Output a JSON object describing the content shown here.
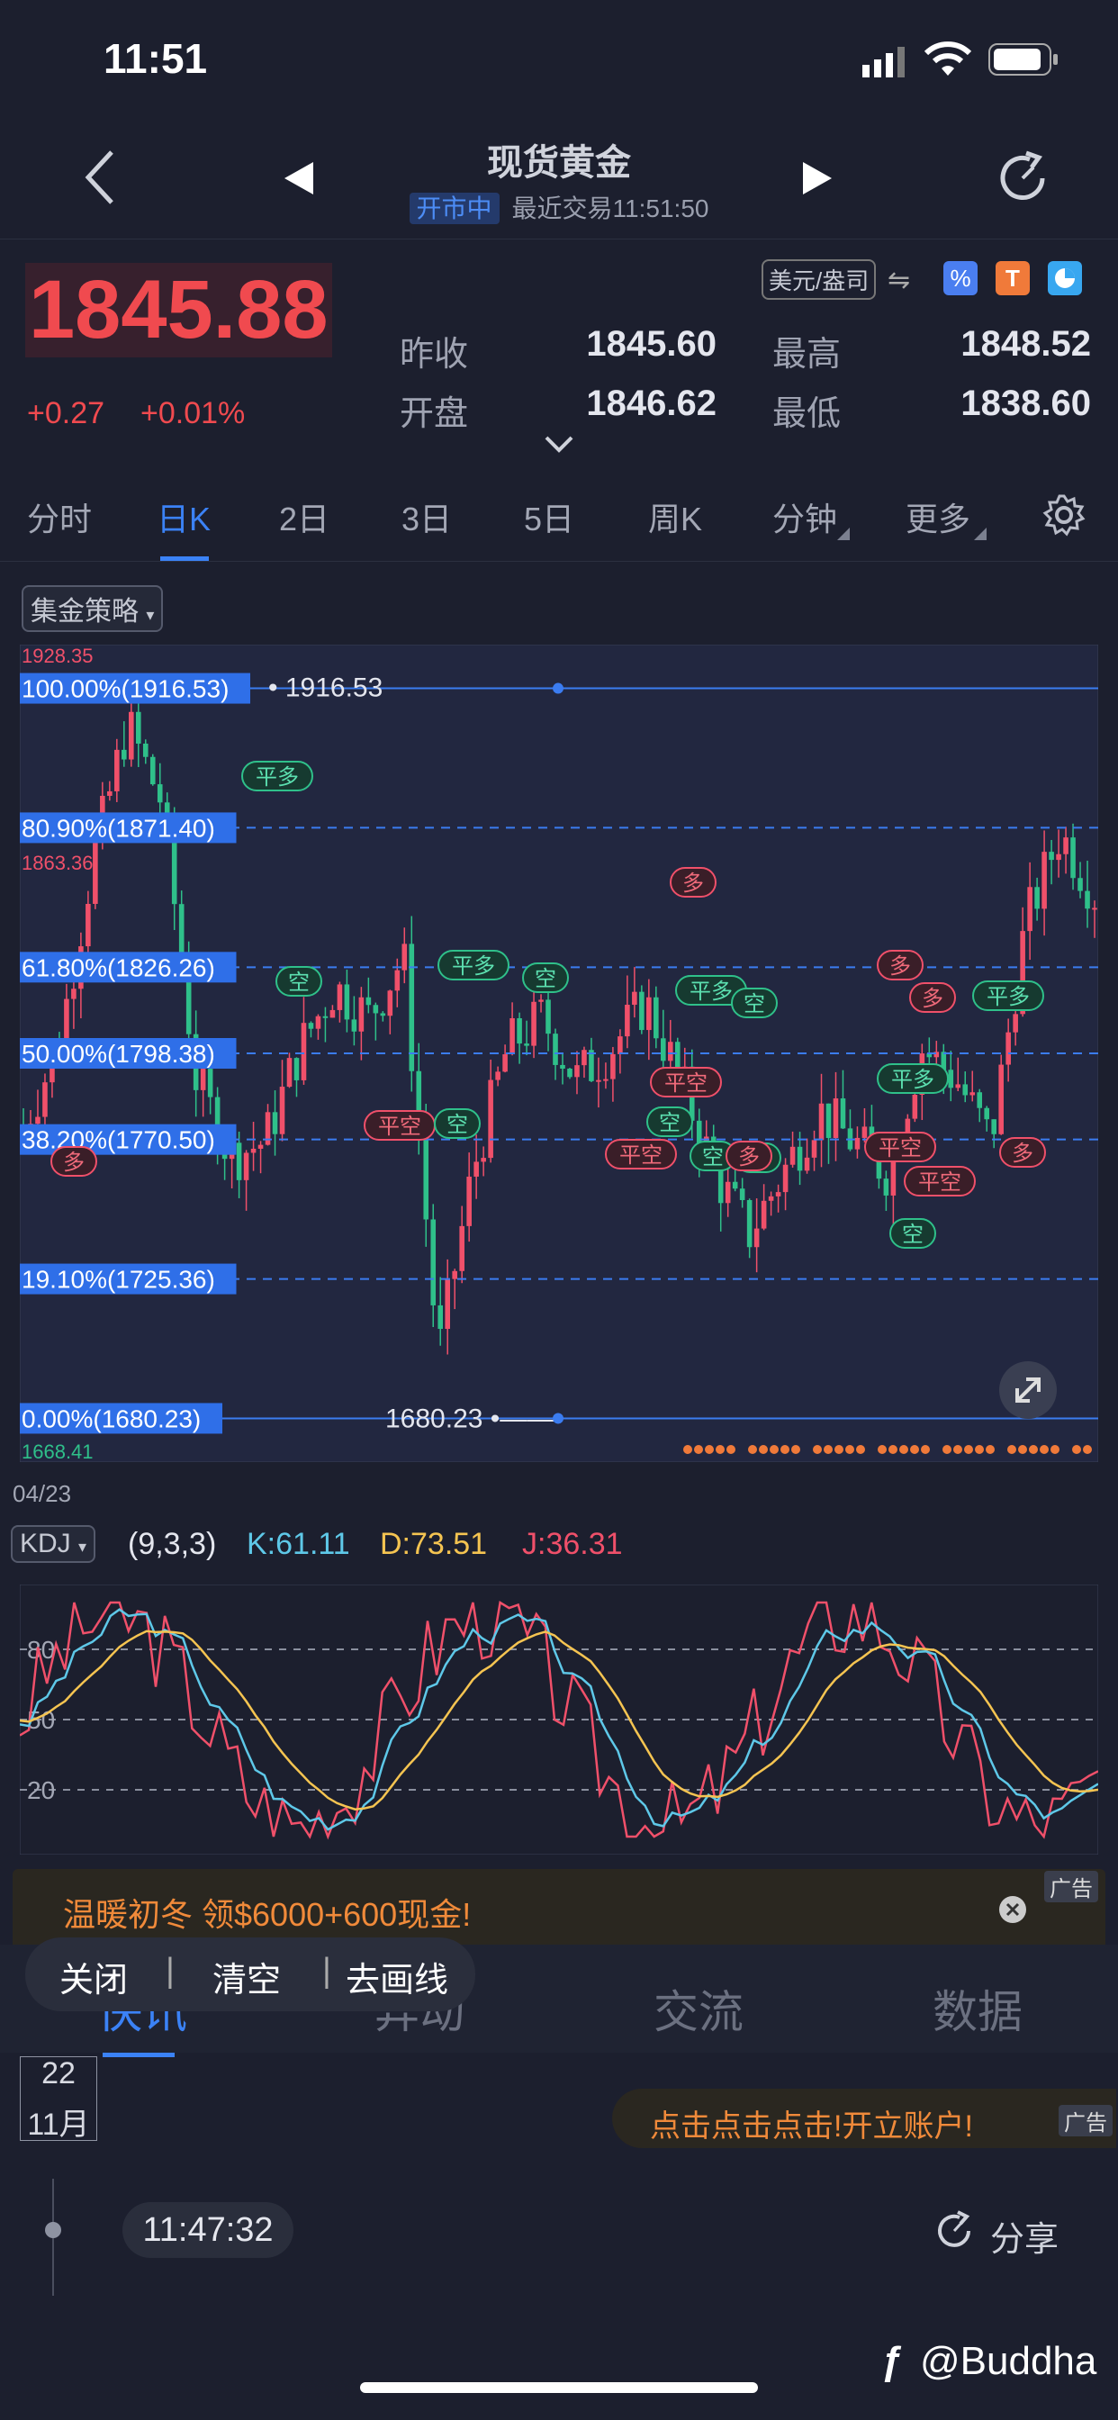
{
  "status": {
    "time": "11:51"
  },
  "header": {
    "title": "现货黄金",
    "market_state": "开市中",
    "last_trade": "最近交易11:51:50"
  },
  "quote": {
    "price": "1845.88",
    "change": "+0.27",
    "change_pct": "+0.01%",
    "unit": "美元/盎司",
    "prev_close_label": "昨收",
    "prev_close": "1845.60",
    "high_label": "最高",
    "high": "1848.52",
    "open_label": "开盘",
    "open": "1846.62",
    "low_label": "最低",
    "low": "1838.60"
  },
  "tabs": [
    "分时",
    "日K",
    "2日",
    "3日",
    "5日",
    "周K",
    "分钟",
    "更多"
  ],
  "active_tab": "日K",
  "strategy_label": "集金策略",
  "chart_data": {
    "type": "candlestick",
    "y_top_label": "1928.35",
    "y_mid_label": "1863.36",
    "y_bottom_label": "1668.41",
    "levels": [
      {
        "label": "100.00%(1916.53)",
        "value": 1916.53
      },
      {
        "label": "80.90%(1871.40)",
        "value": 1871.4
      },
      {
        "label": "61.80%(1826.26)",
        "value": 1826.26
      },
      {
        "label": "50.00%(1798.38)",
        "value": 1798.38
      },
      {
        "label": "38.20%(1770.50)",
        "value": 1770.5
      },
      {
        "label": "19.10%(1725.36)",
        "value": 1725.36
      },
      {
        "label": "0.00%(1680.23)",
        "value": 1680.23
      }
    ],
    "high_marker": "1916.53",
    "low_marker": "1680.23",
    "start_date": "04/23",
    "signals": [
      "平多",
      "空",
      "平多",
      "空",
      "多",
      "平空",
      "空",
      "空",
      "平多",
      "空",
      "多",
      "平空",
      "平空",
      "空",
      "空",
      "多",
      "多",
      "平多",
      "平多",
      "平空",
      "平空",
      "空",
      "多",
      "多"
    ],
    "ylim": [
      1668.41,
      1928.35
    ]
  },
  "kdj": {
    "name": "KDJ",
    "params": "(9,3,3)",
    "k": "K:61.11",
    "d": "D:73.51",
    "j": "J:36.31",
    "levels": [
      "80",
      "50",
      "20"
    ],
    "colors": {
      "k": "#5ec8e8",
      "d": "#f5c451",
      "j": "#f0506a"
    }
  },
  "ad": {
    "text": "温暖初冬 领$6000+600现金!",
    "tag": "广告"
  },
  "toolbar": {
    "close": "关闭",
    "clear": "清空",
    "remove_lines": "去画线"
  },
  "bottom_tabs": [
    "快讯",
    "异动",
    "交流",
    "数据"
  ],
  "news": {
    "day": "22",
    "month": "11月",
    "promo": "点击点击点击!开立账户!",
    "promo_tag": "广告",
    "time": "11:47:32",
    "share": "分享"
  },
  "watermark": "@Buddha"
}
